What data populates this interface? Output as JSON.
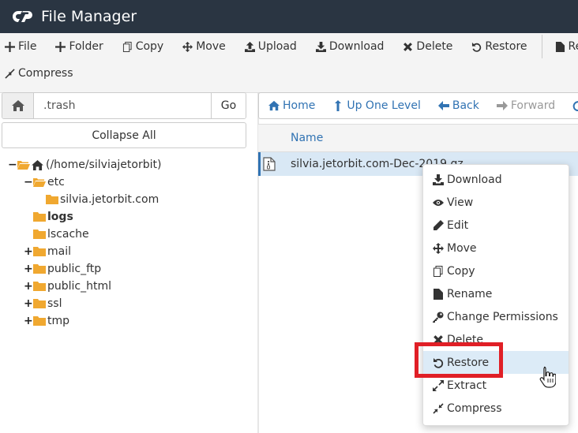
{
  "header": {
    "title": "File Manager"
  },
  "toolbar": {
    "file": "File",
    "folder": "Folder",
    "copy": "Copy",
    "move": "Move",
    "upload": "Upload",
    "download": "Download",
    "delete": "Delete",
    "restore": "Restore",
    "rename": "Ren",
    "compress": "Compress"
  },
  "path": {
    "value": ".trash",
    "go": "Go"
  },
  "left": {
    "collapse_all": "Collapse All"
  },
  "tree": {
    "root": "(/home/silviajetorbit)",
    "etc": "etc",
    "silvia": "silvia.jetorbit.com",
    "logs": "logs",
    "lscache": "lscache",
    "mail": "mail",
    "public_ftp": "public_ftp",
    "public_html": "public_html",
    "ssl": "ssl",
    "tmp": "tmp"
  },
  "nav": {
    "home": "Home",
    "up": "Up One Level",
    "back": "Back",
    "forward": "Forward"
  },
  "table": {
    "col_name": "Name",
    "file_name": "silvia.jetorbit.com-Dec-2019.gz"
  },
  "context_menu": {
    "download": "Download",
    "view": "View",
    "edit": "Edit",
    "move": "Move",
    "copy": "Copy",
    "rename": "Rename",
    "change_permissions": "Change Permissions",
    "delete": "Delete",
    "restore": "Restore",
    "extract": "Extract",
    "compress": "Compress"
  },
  "colors": {
    "header_bg": "#2a3542",
    "link": "#3173b3",
    "highlight": "#dcebf7",
    "callout": "#e01f26",
    "folder": "#f0a830"
  }
}
